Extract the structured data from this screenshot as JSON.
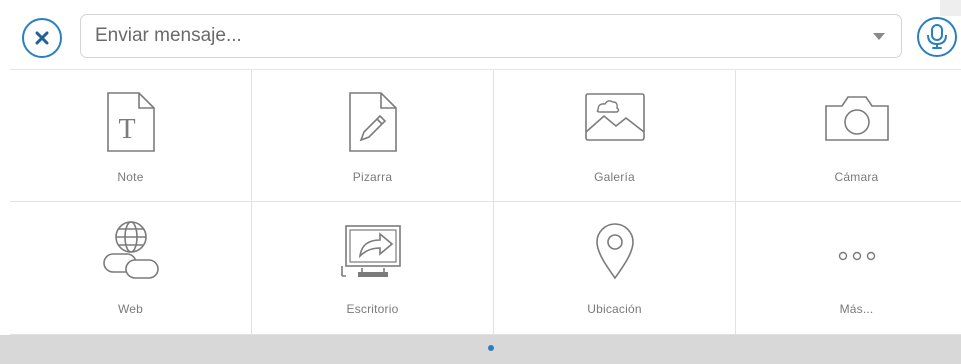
{
  "composer": {
    "placeholder": "Enviar mensaje...",
    "value": "",
    "icons": {
      "close": "close-icon",
      "dropdown": "chevron-down-icon",
      "mic": "microphone-icon"
    }
  },
  "colors": {
    "accent": "#2b7fc0",
    "label": "#7a7a7a",
    "footer": "#d8d8d8"
  },
  "tiles": [
    {
      "label": "Note",
      "icon": "note-icon"
    },
    {
      "label": "Pizarra",
      "icon": "whiteboard-icon"
    },
    {
      "label": "Galería",
      "icon": "gallery-icon"
    },
    {
      "label": "Cámara",
      "icon": "camera-icon"
    },
    {
      "label": "Web",
      "icon": "web-link-icon"
    },
    {
      "label": "Escritorio",
      "icon": "desktop-share-icon"
    },
    {
      "label": "Ubicación",
      "icon": "location-pin-icon"
    },
    {
      "label": "Más...",
      "icon": "more-icon"
    }
  ],
  "pager": {
    "pages": 1,
    "current": 1
  }
}
